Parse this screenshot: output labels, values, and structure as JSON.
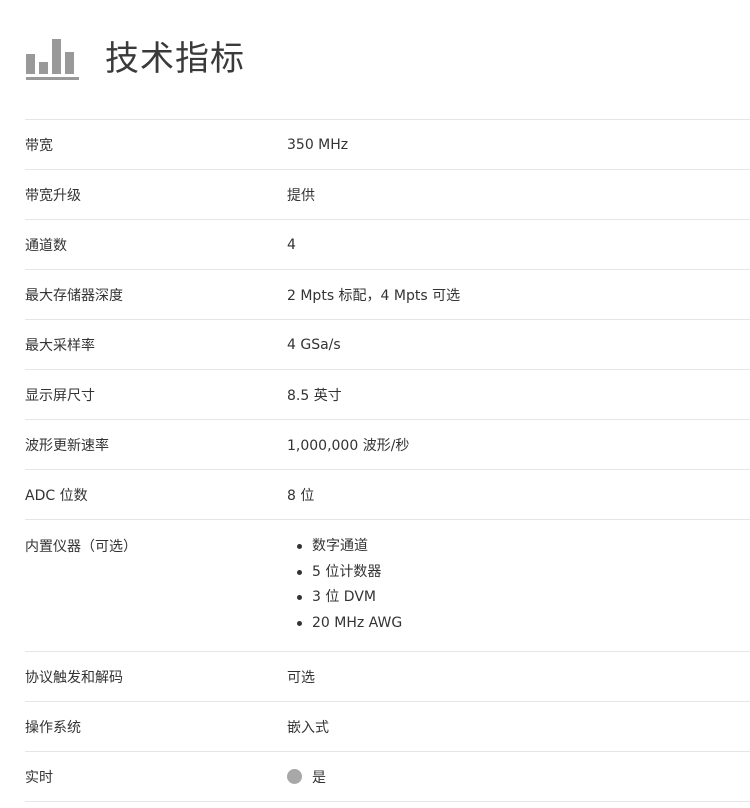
{
  "header": {
    "title": "技术指标",
    "icon": "bar-chart-icon",
    "icon_color": "#999999"
  },
  "specs": [
    {
      "label": "带宽",
      "value": "350 MHz"
    },
    {
      "label": "带宽升级",
      "value": "提供"
    },
    {
      "label": "通道数",
      "value": "4"
    },
    {
      "label": "最大存储器深度",
      "value": "2 Mpts 标配，4 Mpts 可选"
    },
    {
      "label": "最大采样率",
      "value": "4 GSa/s"
    },
    {
      "label": "显示屏尺寸",
      "value": "8.5 英寸"
    },
    {
      "label": "波形更新速率",
      "value": "1,000,000 波形/秒"
    },
    {
      "label": "ADC 位数",
      "value": "8 位"
    }
  ],
  "instruments": {
    "label": "内置仪器（可选）",
    "items": [
      "数字通道",
      "5 位计数器",
      "3 位 DVM",
      "20 MHz AWG"
    ]
  },
  "specs_after": [
    {
      "label": "协议触发和解码",
      "value": "可选"
    },
    {
      "label": "操作系统",
      "value": "嵌入式"
    }
  ],
  "realtime": {
    "label": "实时",
    "value": "是",
    "dot_color": "#a8a8a8"
  }
}
